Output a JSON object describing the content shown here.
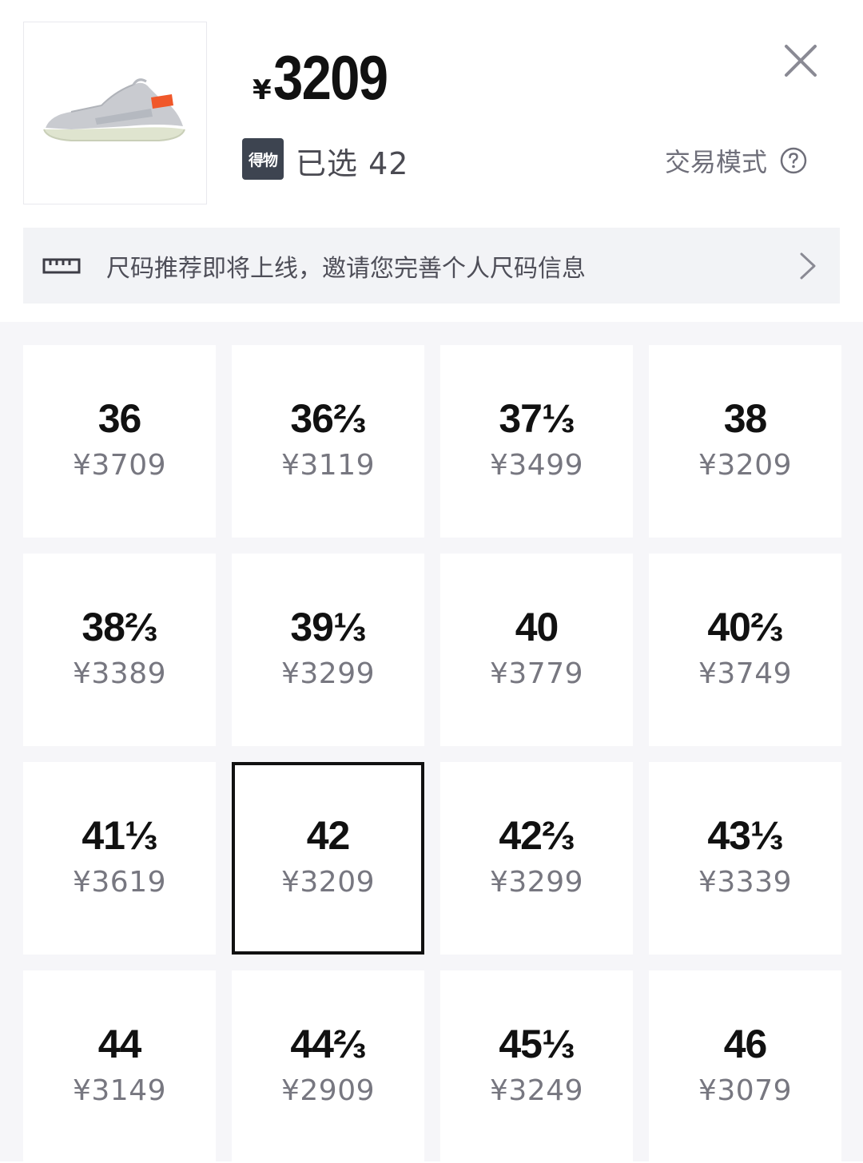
{
  "header": {
    "price_symbol": "¥",
    "price_value": "3209",
    "brand_badge": "得物",
    "selected_text": "已选 42",
    "trade_mode_label": "交易模式"
  },
  "banner": {
    "text": "尺码推荐即将上线，邀请您完善个人尺码信息"
  },
  "sizes": [
    {
      "size": "36",
      "price": "¥3709"
    },
    {
      "size": "36⅔",
      "price": "¥3119"
    },
    {
      "size": "37⅓",
      "price": "¥3499"
    },
    {
      "size": "38",
      "price": "¥3209"
    },
    {
      "size": "38⅔",
      "price": "¥3389"
    },
    {
      "size": "39⅓",
      "price": "¥3299"
    },
    {
      "size": "40",
      "price": "¥3779"
    },
    {
      "size": "40⅔",
      "price": "¥3749"
    },
    {
      "size": "41⅓",
      "price": "¥3619"
    },
    {
      "size": "42",
      "price": "¥3209",
      "selected": true
    },
    {
      "size": "42⅔",
      "price": "¥3299"
    },
    {
      "size": "43⅓",
      "price": "¥3339"
    },
    {
      "size": "44",
      "price": "¥3149"
    },
    {
      "size": "44⅔",
      "price": "¥2909"
    },
    {
      "size": "45⅓",
      "price": "¥3249"
    },
    {
      "size": "46",
      "price": "¥3079"
    }
  ],
  "icons": {
    "close": "close-icon",
    "help": "help-circle-icon",
    "ruler": "ruler-icon",
    "chevron": "chevron-right-icon",
    "product": "sneaker-image"
  },
  "colors": {
    "accent_orange": "#f0582a",
    "badge_bg": "#3d4450",
    "grid_bg": "#f6f6f9",
    "banner_bg": "#f2f3f6",
    "selected_border": "#111111"
  }
}
